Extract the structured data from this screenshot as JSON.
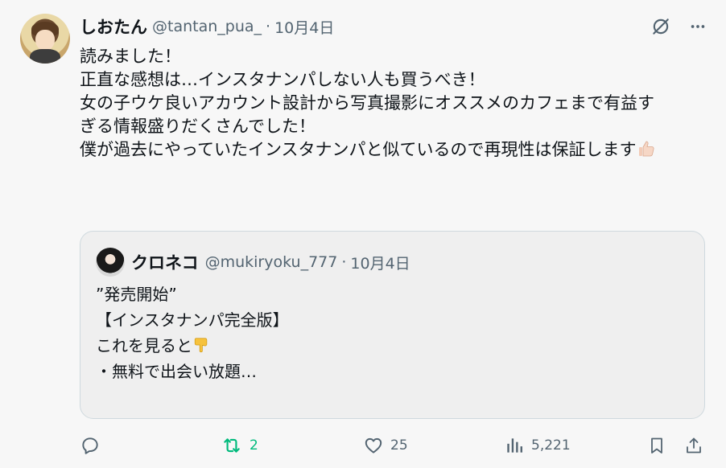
{
  "tweet": {
    "display_name": "しおたん",
    "handle": "@tantan_pua_",
    "separator": "·",
    "date": "10月4日",
    "lines": [
      "読みました！",
      "",
      "正直な感想は…インスタナンパしない人も買うべき！",
      "",
      "女の子ウケ良いアカウント設計から写真撮影にオススメのカフェまで有益す",
      "ぎる情報盛りだくさんでした！"
    ],
    "last_line": "僕が過去にやっていたインスタナンパと似ているので再現性は保証します"
  },
  "quote": {
    "display_name": "クロネコ",
    "handle": "@mukiryoku_777",
    "separator": "·",
    "date": "10月4日",
    "lines": [
      "”発売開始”",
      "【インスタナンパ完全版】",
      ""
    ],
    "line_with_emoji": "これを見ると",
    "last_line": "・無料で出会い放題…"
  },
  "actions": {
    "reply_count": "",
    "retweet_count": "2",
    "like_count": "25",
    "views_count": "5,221"
  },
  "icons": {
    "top_right": [
      "grok-icon",
      "more-icon"
    ],
    "actions": [
      "reply-icon",
      "retweet-icon",
      "like-icon",
      "views-icon",
      "bookmark-icon",
      "share-icon"
    ]
  },
  "colors": {
    "retweet_active": "#00ba7c",
    "secondary_text": "#536471",
    "border": "#cfd9de"
  }
}
